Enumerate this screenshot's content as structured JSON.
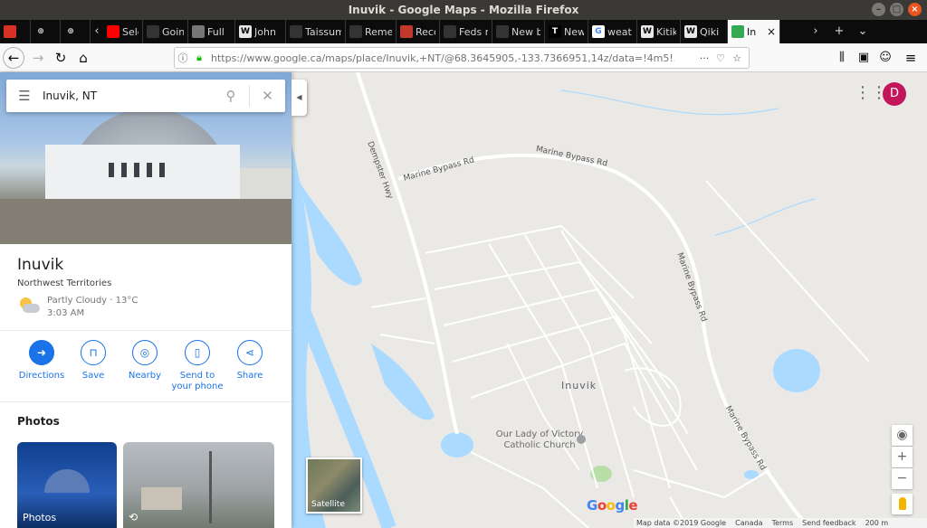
{
  "window": {
    "title": "Inuvik - Google Maps - Mozilla Firefox"
  },
  "tabs": [
    {
      "label": "",
      "icon": "gmail-icon",
      "color": "#d93025"
    },
    {
      "label": "",
      "icon": "globe-icon",
      "color": "#555555"
    },
    {
      "label": "",
      "icon": "globe-icon",
      "color": "#555555"
    },
    {
      "label": "Sele",
      "icon": "youtube-icon",
      "color": "#ff0000"
    },
    {
      "label": "Goin",
      "icon": "blank-icon",
      "color": "#333333"
    },
    {
      "label": "Full",
      "icon": "building-icon",
      "color": "#777777"
    },
    {
      "label": "John",
      "icon": "wikipedia-icon",
      "color": "#e8e8e8"
    },
    {
      "label": "Taissum",
      "icon": "blank-icon",
      "color": "#333333"
    },
    {
      "label": "Remem",
      "icon": "blank-icon",
      "color": "#333333"
    },
    {
      "label": "Reco",
      "icon": "news-icon",
      "color": "#c0392b"
    },
    {
      "label": "Feds re",
      "icon": "blank-icon",
      "color": "#333333"
    },
    {
      "label": "New bo",
      "icon": "blank-icon",
      "color": "#333333"
    },
    {
      "label": "New",
      "icon": "nyt-icon",
      "color": "#000000"
    },
    {
      "label": "weat",
      "icon": "google-icon",
      "color": "#4285f4"
    },
    {
      "label": "Kitik",
      "icon": "wikipedia-icon",
      "color": "#e8e8e8"
    },
    {
      "label": "Qiki",
      "icon": "wikipedia-icon",
      "color": "#e8e8e8"
    },
    {
      "label": "In",
      "icon": "google-maps-icon",
      "color": "#34a853",
      "active": true
    }
  ],
  "navbar": {
    "url": "https://www.google.ca/maps/place/Inuvik,+NT/@68.3645905,-133.7366951,14z/data=!4m5!3m"
  },
  "search": {
    "value": "Inuvik, NT"
  },
  "place": {
    "name": "Inuvik",
    "region": "Northwest Territories",
    "weather": "Partly Cloudy · 13°C",
    "time": "3:03 AM"
  },
  "actions": [
    {
      "label": "Directions",
      "icon": "directions-icon"
    },
    {
      "label": "Save",
      "icon": "bookmark-icon"
    },
    {
      "label": "Nearby",
      "icon": "nearby-icon"
    },
    {
      "label": "Send to your phone",
      "icon": "phone-icon"
    },
    {
      "label": "Share",
      "icon": "share-icon"
    }
  ],
  "photos": {
    "heading": "Photos",
    "first_label": "Photos"
  },
  "map": {
    "town": "Inuvik",
    "church": "Our Lady of Victory Catholic Church",
    "roads": [
      "Dempster Hwy",
      "Marine Bypass Rd",
      "Marine Bypass Rd",
      "Marine Bypass Rd",
      "Marine Bypass Rd"
    ],
    "satellite_label": "Satellite",
    "logo": "Google",
    "attribution": {
      "data": "Map data ©2019 Google",
      "country": "Canada",
      "terms": "Terms",
      "feedback": "Send feedback",
      "scale": "200 m"
    }
  },
  "user": {
    "initial": "D",
    "avatar_color": "#c2185b"
  },
  "colors": {
    "accent": "#1a73e8",
    "water": "#aadaff",
    "park": "#b9dfa8"
  }
}
